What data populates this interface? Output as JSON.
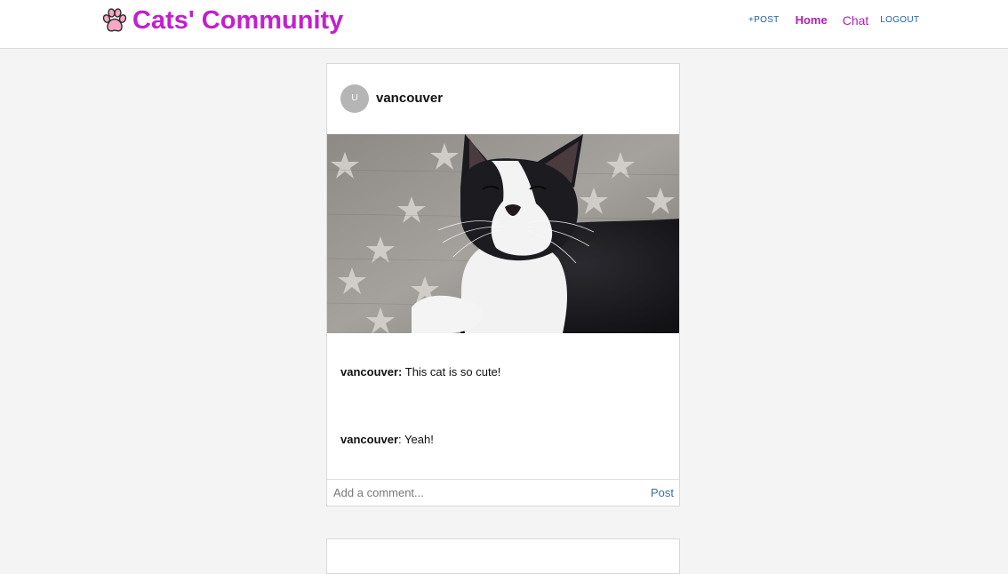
{
  "header": {
    "title": "Cats' Community",
    "logo_icon": "paw-icon",
    "brand_color": "#c21fcf"
  },
  "nav": {
    "post_label": "+POST",
    "home_label": "Home",
    "chat_label": "Chat",
    "logout_label": "LOGOUT"
  },
  "post": {
    "avatar_letter": "U",
    "username": "vancouver",
    "image_icon": "cat-photo",
    "comments": [
      {
        "author": "vancouver:",
        "text": " This cat is so cute!"
      },
      {
        "author": "vancouver",
        "text": ": Yeah!"
      }
    ],
    "comment_placeholder": "Add a comment...",
    "post_button": "Post"
  }
}
